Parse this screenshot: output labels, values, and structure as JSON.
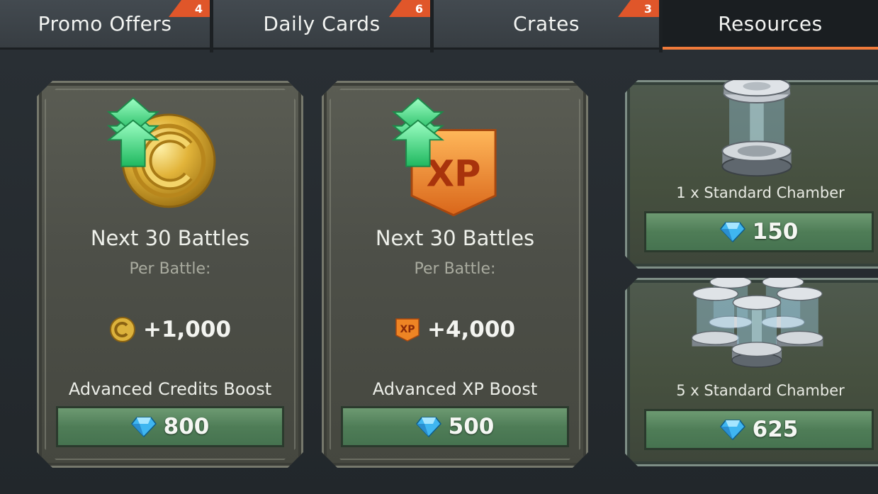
{
  "tabs": [
    {
      "label": "Promo Offers",
      "badge": "4"
    },
    {
      "label": "Daily Cards",
      "badge": "6"
    },
    {
      "label": "Crates",
      "badge": "3"
    },
    {
      "label": "Resources",
      "badge": ""
    }
  ],
  "active_tab": "Resources",
  "offers": [
    {
      "title": "Next 30 Battles",
      "subtitle": "Per Battle:",
      "reward_icon": "credit-coin-icon",
      "reward": "+1,000",
      "name": "Advanced Credits Boost",
      "price": "800",
      "currency_icon": "gem-icon"
    },
    {
      "title": "Next 30 Battles",
      "subtitle": "Per Battle:",
      "reward_icon": "xp-icon",
      "reward_icon_text": "XP",
      "reward": "+4,000",
      "name": "Advanced XP Boost",
      "price": "500",
      "currency_icon": "gem-icon"
    }
  ],
  "chambers": [
    {
      "name": "1 x Standard Chamber",
      "price": "150",
      "currency_icon": "gem-icon"
    },
    {
      "name": "5 x Standard Chamber",
      "price": "625",
      "currency_icon": "gem-icon"
    }
  ],
  "art": {
    "xp_badge_text": "XP"
  },
  "colors": {
    "accent": "#f07a3a",
    "badge": "#e0562a",
    "price_button": "#4f7d57",
    "gem": "#3fb6f0",
    "coin": "#d9a92c",
    "xp_badge": "#ee8424",
    "boost_arrow": "#3fdc7c"
  }
}
